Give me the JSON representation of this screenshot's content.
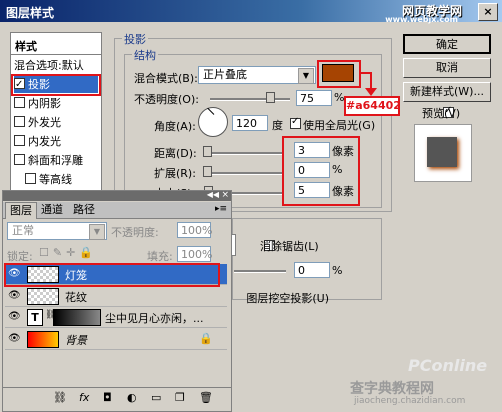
{
  "window": {
    "title": "图层样式",
    "close_glyph": "×"
  },
  "watermark_top": {
    "main": "网页教学网",
    "sub": "www.webjx.com"
  },
  "watermark_bottom": {
    "main": "PConline",
    "sub": "查字典教程网",
    "url": "jiaocheng.chazidian.com"
  },
  "style_list": {
    "header": "样式",
    "items": [
      {
        "label": "混合选项:默认",
        "checkbox": false,
        "checked": false,
        "selected": false
      },
      {
        "label": "投影",
        "checkbox": true,
        "checked": true,
        "selected": true
      },
      {
        "label": "内阴影",
        "checkbox": true,
        "checked": false,
        "selected": false
      },
      {
        "label": "外发光",
        "checkbox": true,
        "checked": false,
        "selected": false
      },
      {
        "label": "内发光",
        "checkbox": true,
        "checked": false,
        "selected": false
      },
      {
        "label": "斜面和浮雕",
        "checkbox": true,
        "checked": false,
        "selected": false
      },
      {
        "label": "等高线",
        "checkbox": true,
        "checked": false,
        "selected": false
      }
    ]
  },
  "shadow_panel": {
    "group_title": "投影",
    "sub_title": "结构",
    "blend_mode_label": "混合模式(B):",
    "blend_mode_value": "正片叠底",
    "color_swatch": "#a64402",
    "color_callout": "#a64402",
    "opacity_label": "不透明度(O):",
    "opacity_value": "75",
    "opacity_unit": "%",
    "opacity_level_pct": 75,
    "angle_label": "角度(A):",
    "angle_value": "120",
    "angle_unit": "度",
    "global_light_label": "使用全局光(G)",
    "global_light_checked": true,
    "distance_label": "距离(D):",
    "distance_value": "3",
    "distance_unit": "像素",
    "spread_label": "扩展(R):",
    "spread_value": "0",
    "spread_unit": "%",
    "size_label": "大小(S):",
    "size_value": "5",
    "size_unit": "像素",
    "antialias_label": "消除锯齿(L)",
    "noise_value": "0",
    "noise_unit": "%",
    "knockout_label": "图层挖空投影(U)"
  },
  "buttons": {
    "ok": "确定",
    "reset": "取消",
    "new_style": "新建样式(W)...",
    "preview": "预览(V)"
  },
  "preview_checked": true,
  "layers_panel": {
    "tabs": [
      "图层",
      "通道",
      "路径"
    ],
    "blend_mode": "正常",
    "opacity_label": "不透明度:",
    "opacity_value": "100%",
    "lock_label": "锁定:",
    "fill_label": "填充:",
    "fill_value": "100%",
    "layers": [
      {
        "name": "灯笼",
        "selected": true
      },
      {
        "name": "花纹",
        "selected": false
      },
      {
        "name": "尘中见月心亦闲，...",
        "selected": false,
        "type_badge": "T"
      },
      {
        "name": "背景",
        "selected": false,
        "locked": true
      }
    ],
    "footer_icons": [
      "link-icon",
      "fx-icon",
      "mask-icon",
      "adjustment-icon",
      "folder-icon",
      "new-layer-icon",
      "trash-icon"
    ]
  }
}
